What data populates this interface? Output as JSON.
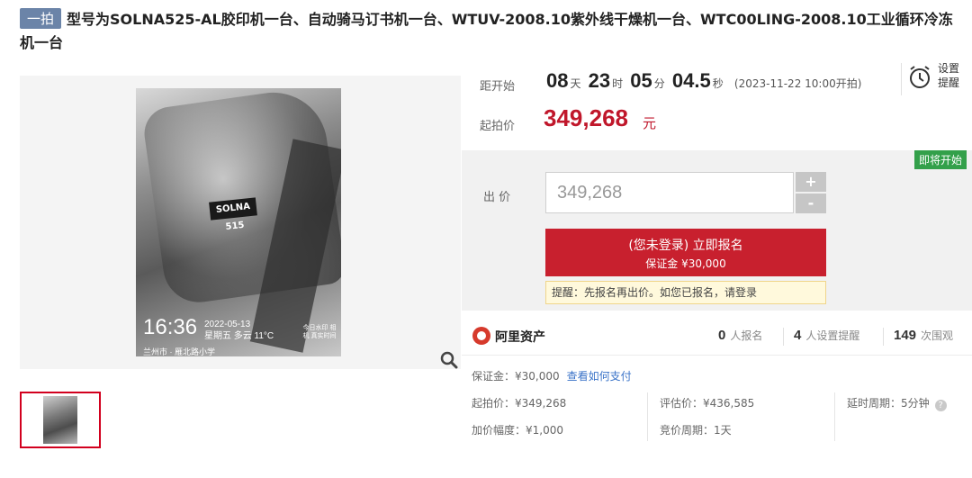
{
  "title": {
    "tag": "一拍",
    "text": "型号为SOLNA525-AL胶印机一台、自动骑马订书机一台、WTUV-2008.10紫外线干燥机一台、WTC00LING-2008.10工业循环冷冻机一台"
  },
  "gallery": {
    "sign_text": "SOLNA 515",
    "time": "16:36",
    "date_line1": "2022-05-13",
    "date_line2": "星期五 多云 11°C",
    "location": "兰州市 · 雁北路小学",
    "watermark": "今日水印 相机 真实时间",
    "zoom_icon": "magnifier-icon"
  },
  "countdown": {
    "label": "距开始",
    "days": "08",
    "days_unit": "天",
    "hours": "23",
    "hours_unit": "时",
    "minutes": "05",
    "minutes_unit": "分",
    "seconds": "04.5",
    "seconds_unit": "秒",
    "start_time": "(2023-11-22 10:00开拍)"
  },
  "start_price": {
    "label": "起拍价",
    "value": "349,268",
    "unit": "元"
  },
  "reminder": {
    "icon": "alarm-clock-icon",
    "label": "设置提醒"
  },
  "bid": {
    "badge": "即将开始",
    "label": "出 价",
    "input_value": "349,268",
    "plus": "+",
    "minus": "-",
    "signup_line1": "(您未登录) 立即报名",
    "signup_line2": "保证金 ¥30,000",
    "tip": "提醒：先报名再出价。如您已报名，请登录"
  },
  "stats": {
    "brand": "阿里资产",
    "registered_count": "0",
    "registered_label": "人报名",
    "reminder_count": "4",
    "reminder_label": "人设置提醒",
    "views_count": "149",
    "views_label": "次围观"
  },
  "details": {
    "deposit": "保证金：¥30,000",
    "deposit_link": "查看如何支付",
    "start_price": "起拍价：¥349,268",
    "assessed_price": "评估价：¥436,585",
    "extension": "延时周期：5分钟",
    "increment": "加价幅度：¥1,000",
    "bid_cycle": "竞价周期：1天"
  },
  "colors": {
    "accent_red": "#c8202e",
    "price_red": "#c0172b",
    "badge_green": "#33a04a",
    "tag_blue": "#6b84a8",
    "link_blue": "#3a73c8"
  }
}
